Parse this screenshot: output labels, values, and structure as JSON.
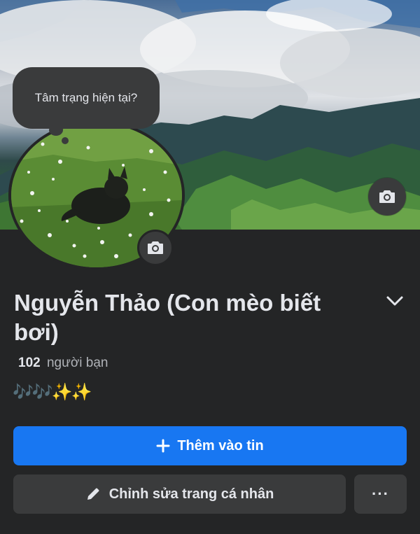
{
  "profile": {
    "mood_prompt": "Tâm trạng hiện tại?",
    "name": "Nguyễn Thảo (Con mèo biết bơi)",
    "friends_count": "102",
    "friends_label": "người bạn",
    "bio": "🎶🎶✨✨"
  },
  "actions": {
    "add_story_label": "Thêm vào tin",
    "edit_profile_label": "Chỉnh sửa trang cá nhân",
    "more_label": "···"
  },
  "icons": {
    "cover_camera": "camera-icon",
    "avatar_camera": "camera-icon",
    "expand": "chevron-down-icon",
    "add": "plus-icon",
    "edit": "pencil-icon"
  },
  "colors": {
    "background": "#242526",
    "button_secondary": "#3a3b3c",
    "accent": "#1877f2",
    "text_primary": "#e4e6eb",
    "text_secondary": "#b0b3b8"
  }
}
